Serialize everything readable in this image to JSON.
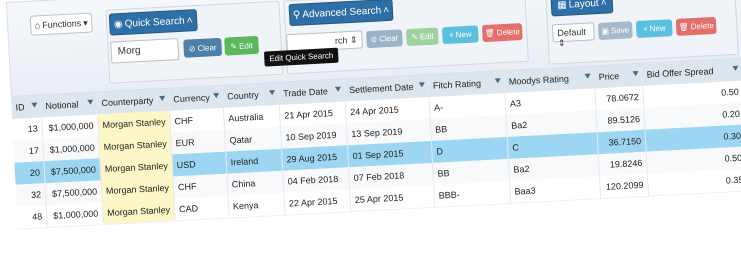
{
  "toolbar": {
    "functions_label": "Functions",
    "quick_search": {
      "title": "Quick Search",
      "value": "Morg",
      "clear_label": "Clear",
      "edit_label": "Edit",
      "tooltip": "Edit Quick Search"
    },
    "advanced_search": {
      "title": "Advanced Search",
      "select_value": "rch",
      "clear_label": "Clear",
      "edit_label": "Edit",
      "new_label": "New",
      "delete_label": "Delete"
    },
    "layout": {
      "title": "Layout",
      "select_value": "Default",
      "save_label": "Save",
      "new_label": "New",
      "delete_label": "Delete"
    }
  },
  "grid": {
    "columns": [
      "ID",
      "Notional",
      "Counterparty",
      "Currency",
      "Country",
      "Trade Date",
      "Settlement Date",
      "Fitch Rating",
      "Moodys Rating",
      "Price",
      "Bid Offer Spread"
    ],
    "rows": [
      [
        "13",
        "$1,000,000",
        "Morgan Stanley",
        "CHF",
        "Australia",
        "21 Apr 2015",
        "24 Apr 2015",
        "A-",
        "A3",
        "78.0672",
        "0.50"
      ],
      [
        "17",
        "$1,000,000",
        "Morgan Stanley",
        "EUR",
        "Qatar",
        "10 Sep 2019",
        "13 Sep 2019",
        "BB",
        "Ba2",
        "89.5126",
        "0.20"
      ],
      [
        "20",
        "$7,500,000",
        "Morgan Stanley",
        "USD",
        "Ireland",
        "29 Aug 2015",
        "01 Sep 2015",
        "D",
        "C",
        "36.7150",
        "0.30"
      ],
      [
        "32",
        "$7,500,000",
        "Morgan Stanley",
        "CHF",
        "China",
        "04 Feb 2018",
        "07 Feb 2018",
        "BB",
        "Ba2",
        "19.8246",
        "0.50"
      ],
      [
        "48",
        "$1,000,000",
        "Morgan Stanley",
        "CAD",
        "Kenya",
        "22 Apr 2015",
        "25 Apr 2015",
        "BBB-",
        "Baa3",
        "120.2099",
        "0.35"
      ]
    ],
    "selected_row": 2
  },
  "icons": {
    "functions": "home-icon",
    "quick_search": "eye-icon",
    "advanced_search": "search-icon",
    "layout": "grid-icon",
    "clear": "clear-filter-icon",
    "edit": "edit-icon",
    "new": "plus-icon",
    "delete": "trash-icon",
    "save": "save-icon"
  },
  "colors": {
    "header_button": "#2f6fa8",
    "selected_row": "#9dd6f2",
    "counterparty_highlight": "#fdf7c7",
    "edit": "#5cb85c",
    "delete": "#e36e6a",
    "new": "#5bc0de"
  }
}
